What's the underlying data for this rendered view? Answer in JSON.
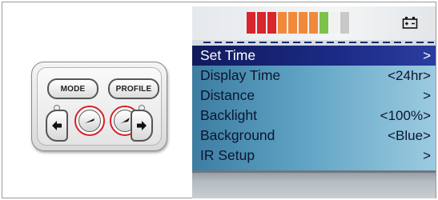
{
  "keypad": {
    "mode_label": "MODE",
    "profile_label": "PROFILE"
  },
  "display": {
    "gauge_segments": [
      "#d9252b",
      "#d9252b",
      "#d9252b",
      "#f08a3a",
      "#f08a3a",
      "#f08a3a",
      "#f08a3a",
      "#7cc24a",
      "#f1f1f1",
      "#c8c8c8"
    ],
    "battery_icon": "battery-plus-minus-icon",
    "menu": [
      {
        "label": "Set Time",
        "value": ">",
        "selected": true
      },
      {
        "label": "Display Time",
        "value": "<24hr>"
      },
      {
        "label": "Distance",
        "value": ">"
      },
      {
        "label": "Backlight",
        "value": "<100%>"
      },
      {
        "label": "Background",
        "value": "<Blue>"
      },
      {
        "label": "IR Setup",
        "value": ">"
      }
    ]
  },
  "colors": {
    "highlight_ring": "#d81f26",
    "selected_row": "#101a5c"
  }
}
